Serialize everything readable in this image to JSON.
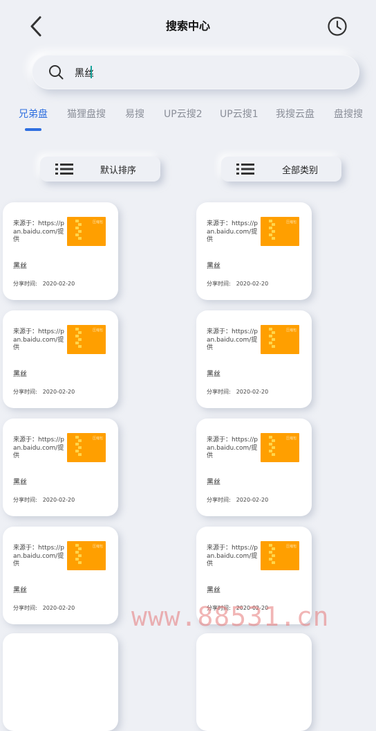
{
  "header": {
    "title": "搜索中心",
    "back_icon": "chevron-left-icon",
    "history_icon": "clock-icon"
  },
  "search": {
    "value": "黑丝",
    "placeholder": ""
  },
  "tabs": [
    {
      "label": "兄弟盘",
      "active": true
    },
    {
      "label": "猫狸盘搜",
      "active": false
    },
    {
      "label": "易搜",
      "active": false
    },
    {
      "label": "UP云搜2",
      "active": false
    },
    {
      "label": "UP云搜1",
      "active": false
    },
    {
      "label": "我搜云盘",
      "active": false
    },
    {
      "label": "盘搜搜",
      "active": false
    }
  ],
  "controls": {
    "sort_label": "默认排序",
    "category_label": "全部类别"
  },
  "results": [
    {
      "source": "来源于：https://pan.baidu.com/提供",
      "thumb_text": "压缩包",
      "name": "黑丝",
      "time_label": "分享时间:",
      "date": "2020-02-20"
    },
    {
      "source": "来源于：https://pan.baidu.com/提供",
      "thumb_text": "压缩包",
      "name": "黑丝",
      "time_label": "分享时间:",
      "date": "2020-02-20"
    },
    {
      "source": "来源于：https://pan.baidu.com/提供",
      "thumb_text": "压缩包",
      "name": "黑丝",
      "time_label": "分享时间:",
      "date": "2020-02-20"
    },
    {
      "source": "来源于：https://pan.baidu.com/提供",
      "thumb_text": "压缩包",
      "name": "黑丝",
      "time_label": "分享时间:",
      "date": "2020-02-20"
    },
    {
      "source": "来源于：https://pan.baidu.com/提供",
      "thumb_text": "压缩包",
      "name": "黑丝",
      "time_label": "分享时间:",
      "date": "2020-02-20"
    },
    {
      "source": "来源于：https://pan.baidu.com/提供",
      "thumb_text": "压缩包",
      "name": "黑丝",
      "time_label": "分享时间:",
      "date": "2020-02-20"
    },
    {
      "source": "来源于：https://pan.baidu.com/提供",
      "thumb_text": "压缩包",
      "name": "黑丝",
      "time_label": "分享时间:",
      "date": "2020-02-20"
    },
    {
      "source": "来源于：https://pan.baidu.com/提供",
      "thumb_text": "压缩包",
      "name": "黑丝",
      "time_label": "分享时间:",
      "date": "2020-02-20"
    }
  ],
  "watermark": "www.88531.cn",
  "colors": {
    "accent": "#2f6fe0",
    "background": "#eef0f5",
    "thumb": "#ff9f00",
    "caret": "#16a39a"
  }
}
